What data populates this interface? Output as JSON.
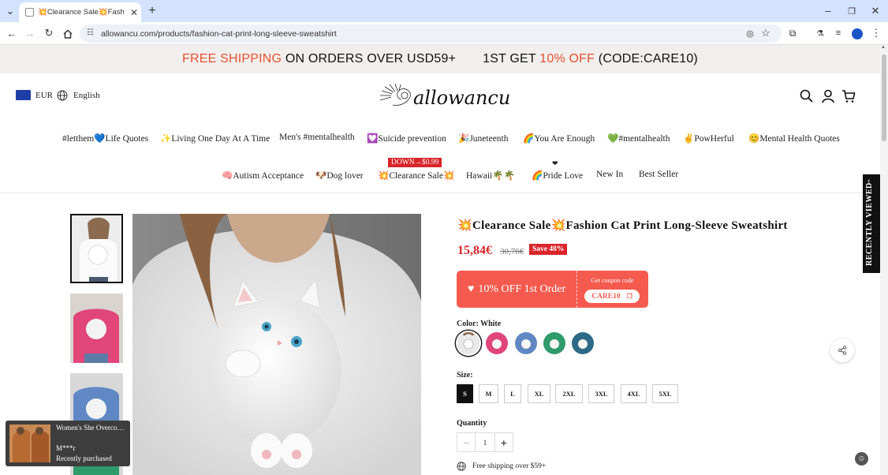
{
  "browser": {
    "tab_title": "💥Clearance Sale💥Fashion Cat",
    "url": "allowancu.com/products/fashion-cat-print-long-sleeve-sweatshirt"
  },
  "promo": {
    "part1_red": "FREE SHIPPING",
    "part1_rest": " ON ORDERS OVER USD59+",
    "part2_a": "1ST GET ",
    "part2_red": "10% OFF",
    "part2_b": " (CODE:CARE10)"
  },
  "header": {
    "currency": "EUR",
    "language": "English",
    "logo_text": "allowancu"
  },
  "nav": {
    "row1": [
      "#letthem💙Life Quotes",
      "✨Living One Day At A Time",
      "Men's #mentalhealth",
      "💟Suicide prevention",
      "🎉Juneteenth",
      "🌈You Are Enough",
      "💚#mentalhealth",
      "✌PowHerful",
      "😊Mental Health Quotes"
    ],
    "row2": [
      "🧠Autism Acceptance",
      "🐶Dog lover",
      "💥Clearance Sale💥",
      "Hawaii🌴🌴",
      "🌈Pride Love",
      "New In",
      "Best Seller"
    ],
    "badge": "DOWN→$0.99"
  },
  "recently_viewed": "RECENTLY VIEWED",
  "product": {
    "title": "💥Clearance Sale💥Fashion Cat Print Long-Sleeve Sweatshirt",
    "price": "15,84€",
    "old_price": "30,76€",
    "save": "Save 48%",
    "coupon": {
      "offer": "10% OFF 1st Order",
      "get_label": "Get coupon code",
      "code": "CARE10"
    },
    "color_label": "Color: White",
    "colors": [
      {
        "name": "White",
        "hex": "#e9e9e9"
      },
      {
        "name": "Pink",
        "hex": "#e0467a"
      },
      {
        "name": "Blue",
        "hex": "#5f88c4"
      },
      {
        "name": "Green",
        "hex": "#2f9a6a"
      },
      {
        "name": "Dark Blue",
        "hex": "#2c6a88"
      }
    ],
    "size_label": "Size:",
    "sizes": [
      "S",
      "M",
      "L",
      "XL",
      "2XL",
      "3XL",
      "4XL",
      "5XL"
    ],
    "selected_size": "S",
    "quantity_label": "Quantity",
    "quantity": "1",
    "shipping": "Free shipping over $59+"
  },
  "popup": {
    "name": "Women's She Overcoat ...",
    "user": "M***r",
    "status": "Recently purchased"
  },
  "colors": {
    "accent_red": "#d9252a",
    "promo_red": "#e8502f",
    "coupon_bg": "#f55a4e"
  }
}
